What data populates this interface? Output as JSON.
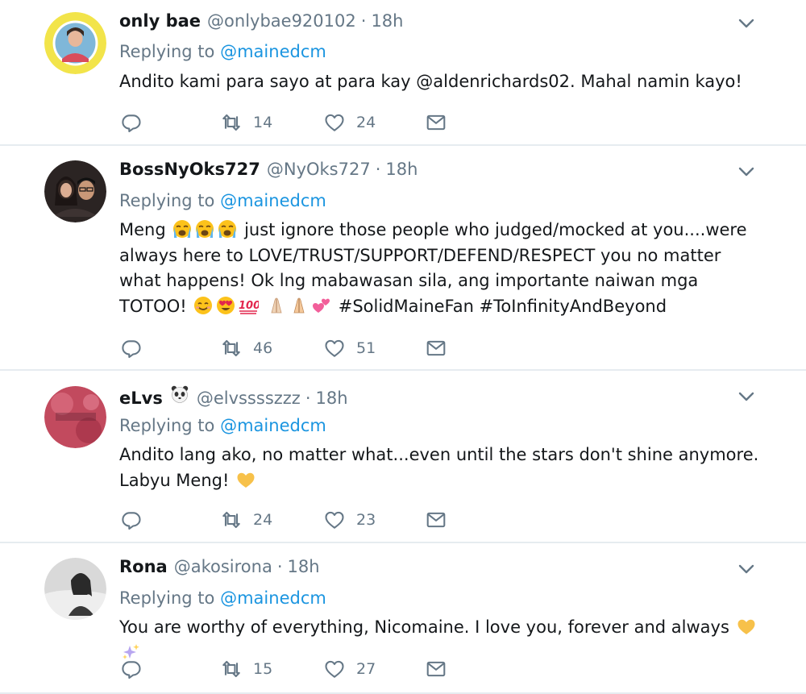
{
  "tweets": [
    {
      "name": "only bae",
      "handle": "@onlybae920102",
      "separator": "·",
      "time": "18h",
      "replying_label": "Replying to",
      "replying_to": "@mainedcm",
      "text": "Andito kami para sayo at para kay @aldenrichards02. Mahal namin kayo!",
      "retweets": "14",
      "likes": "24",
      "avatar_icon": "profile-photo-yellow-badge"
    },
    {
      "name": "BossNyOks727",
      "handle": "@NyOks727",
      "separator": "·",
      "time": "18h",
      "replying_label": "Replying to",
      "replying_to": "@mainedcm",
      "text_parts": [
        "Meng",
        "just ignore those people who judged/mocked at you....were always here to LOVE/TRUST/SUPPORT/DEFEND/RESPECT you no matter what happens! Ok lng mabawasan sila, ang importante naiwan mga TOTOO!",
        "#SolidMaineFan #ToInfinityAndBeyond"
      ],
      "emojis": [
        "loudly-crying-face",
        "smiling-face",
        "heart-eyes-face",
        "hundred-points",
        "folded-hands",
        "two-hearts"
      ],
      "retweets": "46",
      "likes": "51",
      "avatar_icon": "profile-photo-couple"
    },
    {
      "name": "eLvs",
      "handle": "@elvsssszzz",
      "separator": "·",
      "time": "18h",
      "replying_label": "Replying to",
      "replying_to": "@mainedcm",
      "text": "Andito lang ako, no matter what...even until the stars don't shine anymore. Labyu Meng!",
      "emojis": [
        "panda-face",
        "yellow-heart"
      ],
      "retweets": "24",
      "likes": "23",
      "avatar_icon": "profile-photo-red-floral"
    },
    {
      "name": "Rona",
      "handle": "@akosirona",
      "separator": "·",
      "time": "18h",
      "replying_label": "Replying to",
      "replying_to": "@mainedcm",
      "text": "You are worthy of everything, Nicomaine. I love you, forever and always",
      "emojis": [
        "yellow-heart",
        "sparkles"
      ],
      "retweets": "15",
      "likes": "27",
      "avatar_icon": "profile-photo-monochrome"
    }
  ],
  "colors": {
    "link": "#1b95e0",
    "secondary": "#657786",
    "primary": "#14171a",
    "divider": "#e6ecf0"
  },
  "icons": {
    "reply": "reply-icon",
    "retweet": "retweet-icon",
    "like": "heart-icon",
    "message": "envelope-icon",
    "more": "chevron-down-icon"
  }
}
